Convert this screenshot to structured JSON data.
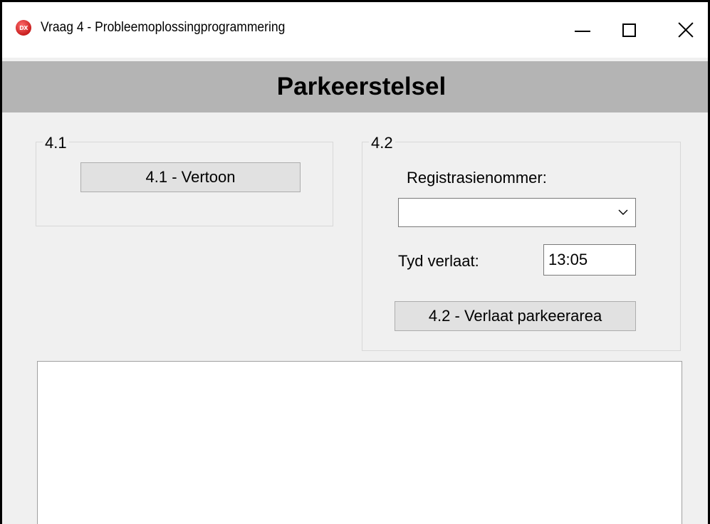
{
  "window": {
    "title": "Vraag 4 - Probleemoplossingprogrammering",
    "icon": "dx-app-icon",
    "icon_text": "DX"
  },
  "header": {
    "title": "Parkeerstelsel",
    "band_color": "#b4b4b4"
  },
  "group_41": {
    "legend": "4.1",
    "button_label": "4.1 - Vertoon"
  },
  "group_42": {
    "legend": "4.2",
    "registration_label": "Registrasienommer:",
    "registration_value": "",
    "time_label": "Tyd verlaat:",
    "time_value": "13:05",
    "button_label": "4.2 - Verlaat parkeerarea"
  },
  "output": {
    "text": ""
  }
}
